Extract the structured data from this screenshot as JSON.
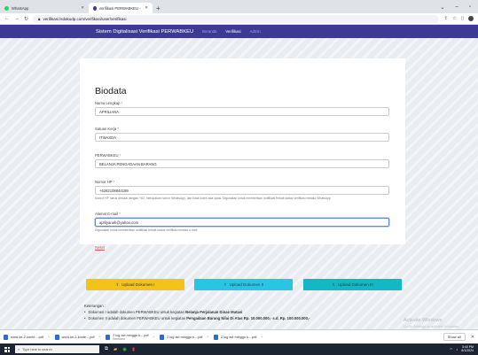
{
  "browser": {
    "tabs": [
      {
        "label": "WhatsApp",
        "active": false
      },
      {
        "label": "Verifikasi PERWABKEU - Sistem Digi",
        "active": true
      }
    ],
    "new_tab": "+",
    "url": "verifikasi.lsdakudp.com/verifikasi/user/verifikasi"
  },
  "page": {
    "brand": "Sistem Digitalisasi Verifikasi PERWABKEU",
    "nav": [
      {
        "label": "Beranda",
        "active": false
      },
      {
        "label": "Verifikasi",
        "active": true
      },
      {
        "label": "Admin",
        "active": false
      }
    ],
    "biodata": {
      "heading": "Biodata",
      "nama": {
        "label": "Nama Lengkap",
        "req": "*",
        "value": "APRILIANA"
      },
      "satuan": {
        "label": "Satuan Kerja",
        "req": "*",
        "value": "ITWASDA"
      },
      "perwabkeu": {
        "label": "PERWABKEU",
        "req": "*",
        "value": "BELANJA PENGADAAN BARANG"
      },
      "hp": {
        "label": "Nomor HP",
        "req": "*",
        "value": "+6282108844189",
        "hint": "Nomor HP harus dimulai dengan +62, merupakan nomor WhatsApp, dan tidak boleh ada spasi. Digunakan untuk memberikan notifikasi terkait status verifikasi melalui WhatsApp"
      },
      "email": {
        "label": "Alamat E-mail",
        "req": "*",
        "value": "aprilyanah@yahoo.com",
        "hint": "Digunakan untuk memberikan notifikasi terkait status verifikasi melalui e-mail"
      },
      "reset": "Reset"
    },
    "uploads": [
      {
        "label": "Upload Dokumen I",
        "color": "#f5c21a"
      },
      {
        "label": "Upload Dokumen II",
        "color": "#29c6e3"
      },
      {
        "label": "Upload Dokumen III",
        "color": "#13b8c6"
      }
    ],
    "notes": {
      "label": "Keterangan :",
      "items": [
        {
          "text": "Dokumen I adalah dokumen PERWABKEU untuk kegiatan ",
          "bold": "Belanja Perjalanan Dinas Mutasi"
        },
        {
          "text": "Dokumen II adalah dokumen PERWABKEU untuk kegiatan ",
          "bold": "Pengadaan Barang Nilai Di Atas Rp. 10.000.000,- s.d. Rp. 100.000.000,-"
        }
      ]
    },
    "watermark": "Activate Windows",
    "watermark_sub": "Go to Settings to activate Windows."
  },
  "downloads": {
    "items": [
      {
        "name": "word-ke-2-konte....pdf",
        "sub": ""
      },
      {
        "name": "word-ke-2-konte....pdf",
        "sub": ""
      },
      {
        "name": "2 log act minggu k....pdf",
        "sub": "Removed"
      },
      {
        "name": "2 log act minggu k....pdf",
        "sub": ""
      },
      {
        "name": "2 log act minggu k....pdf",
        "sub": ""
      }
    ],
    "show_all": "Show all"
  },
  "taskbar": {
    "search_placeholder": "Type here to search",
    "time": "3:40 PM",
    "date": "8/1/2024"
  }
}
